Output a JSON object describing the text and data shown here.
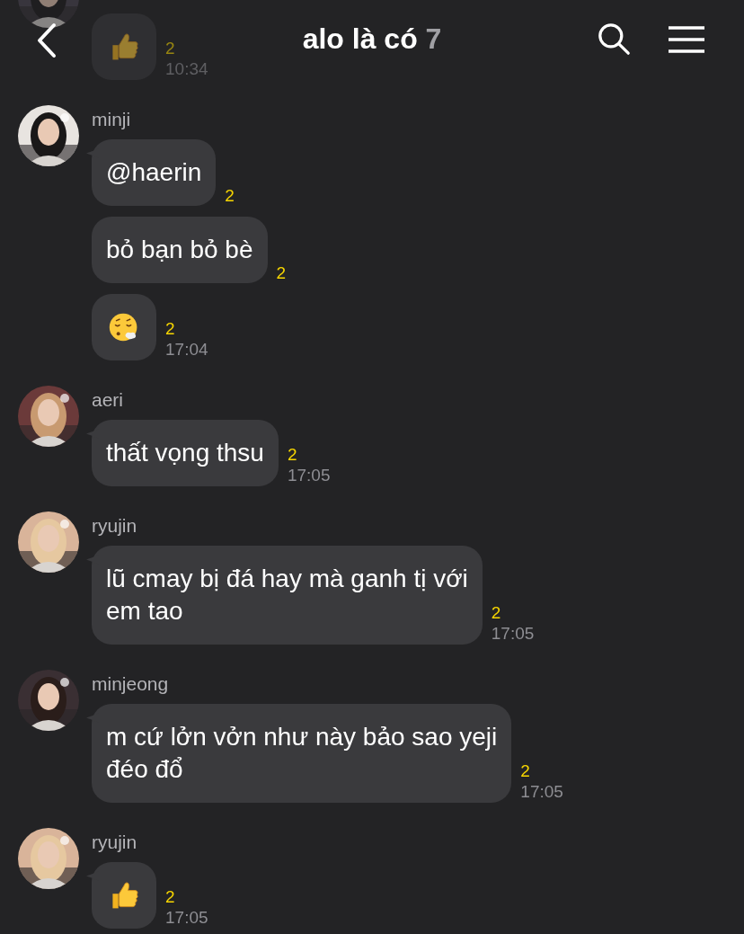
{
  "header": {
    "title": "alo là có",
    "member_count": "7"
  },
  "groups": [
    {
      "messages": [
        {
          "kind": "thumbs",
          "unread": "2",
          "time": "10:34"
        }
      ]
    },
    {
      "sender": "minji",
      "messages": [
        {
          "kind": "text",
          "text": "@haerin",
          "unread": "2"
        },
        {
          "kind": "text",
          "text": "bỏ bạn bỏ bè",
          "unread": "2"
        },
        {
          "kind": "sigh",
          "unread": "2",
          "time": "17:04"
        }
      ]
    },
    {
      "sender": "aeri",
      "messages": [
        {
          "kind": "text",
          "text": "thất vọng thsu",
          "unread": "2",
          "time": "17:05"
        }
      ]
    },
    {
      "sender": "ryujin",
      "messages": [
        {
          "kind": "text",
          "text": "lũ cmay bị đá hay mà ganh tị với\nem tao",
          "unread": "2",
          "time": "17:05"
        }
      ]
    },
    {
      "sender": "minjeong",
      "messages": [
        {
          "kind": "text",
          "text": "m cứ lởn vởn như này bảo sao yeji\nđéo đổ",
          "unread": "2",
          "time": "17:05"
        }
      ]
    },
    {
      "sender": "ryujin",
      "messages": [
        {
          "kind": "thumbs",
          "unread": "2",
          "time": "17:05"
        }
      ]
    }
  ]
}
